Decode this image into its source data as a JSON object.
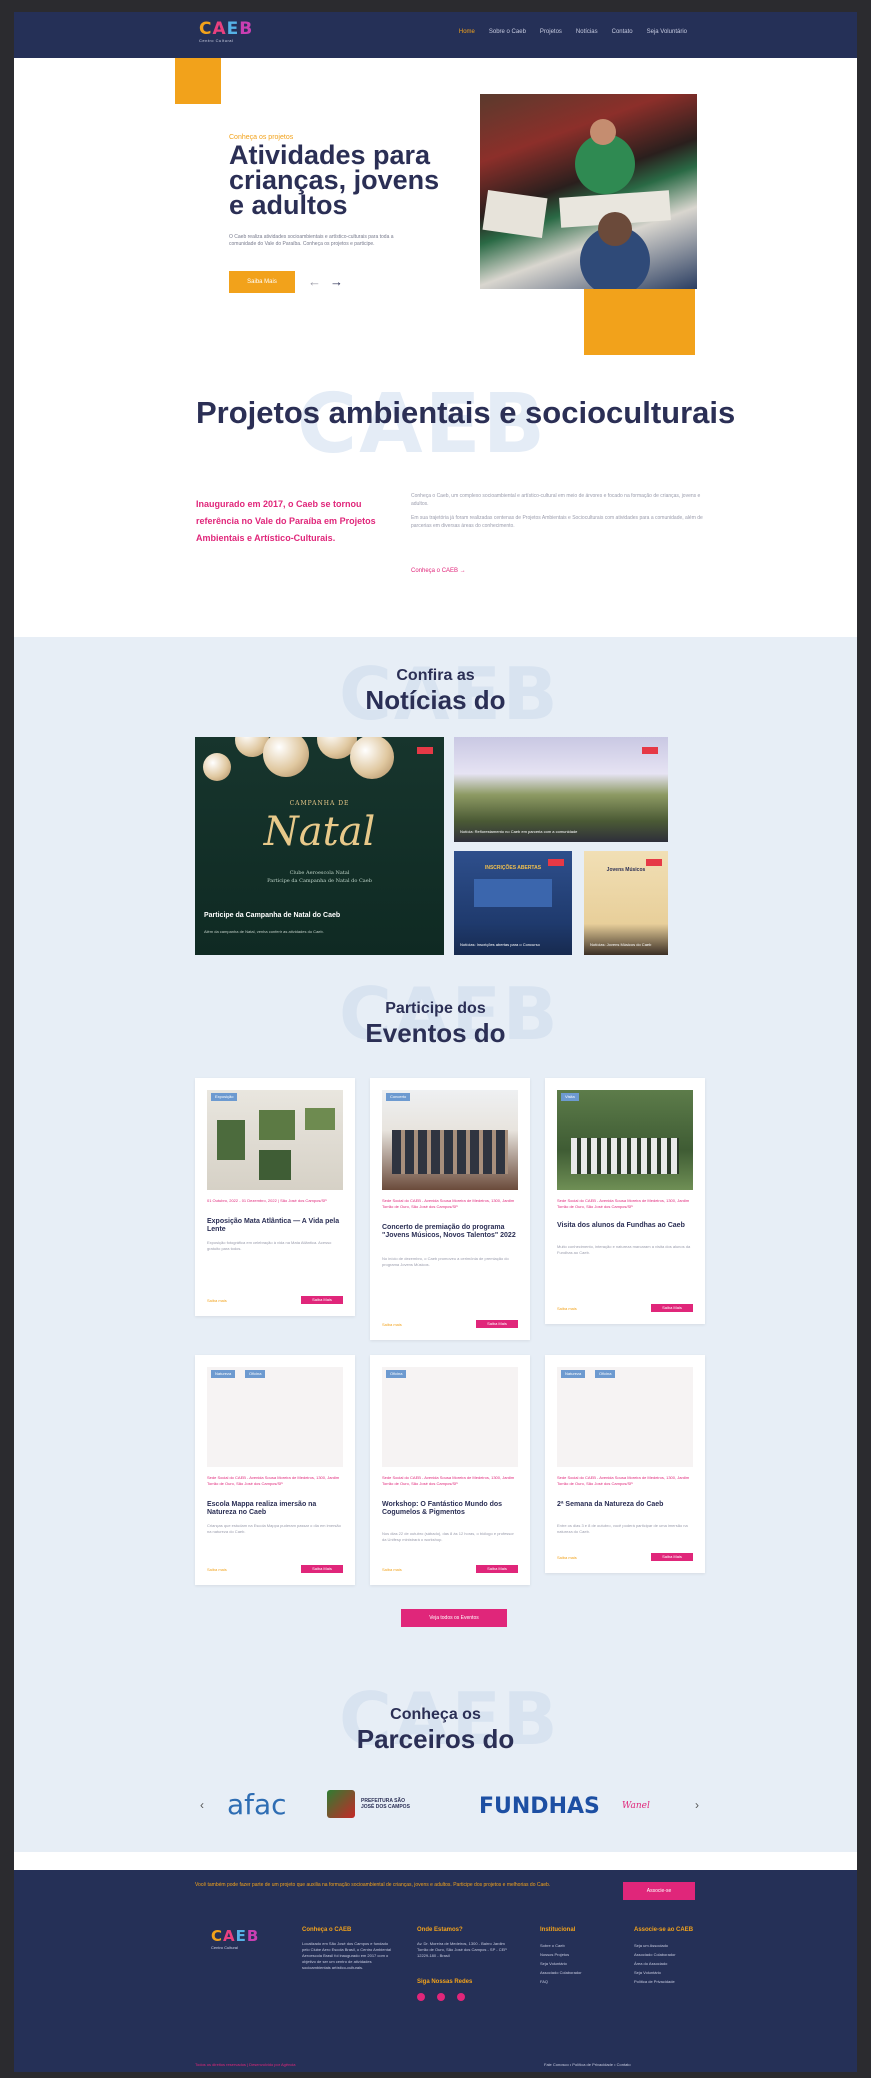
{
  "header": {
    "logo_text": "CAEB",
    "logo_sub": "Centro Cultural",
    "nav": [
      "Home",
      "Sobre o Caeb",
      "Projetos",
      "Notícias",
      "Contato",
      "Seja Voluntário"
    ]
  },
  "hero": {
    "kicker": "Conheça os projetos",
    "title": "Atividades para crianças, jovens e adultos",
    "desc": "O Caeb realiza atividades socioambientais e artístico-culturais para toda a comunidade do Vale do Paraíba. Conheça os projetos e participe.",
    "button": "Saiba Mais",
    "prev_icon": "←",
    "next_icon": "→"
  },
  "projects": {
    "watermark": "CAEB",
    "title": "Projetos ambientais e socioculturais",
    "lead": "Inaugurado em 2017, o Caeb se tornou referência no Vale do Paraíba em Projetos Ambientais e Artístico-Culturais.",
    "p1": "Conheça o Caeb, um complexo socioambiental e artístico-cultural em meio de árvores e focado na formação de crianças, jovens e adultos.",
    "p2": "Em sua trajetória já foram realizadas centenas de Projetos Ambientais e Socioculturais com atividades para a comunidade, além de parcerias em diversas áreas do conhecimento.",
    "link": "Conheça o CAEB →"
  },
  "news": {
    "watermark": "CAEB",
    "sub": "Confira as",
    "title": "Notícias do",
    "big_banner": "CAMPANHA DE",
    "big_script": "Natal",
    "big_line1": "Clube Aeroescola Natal",
    "big_line2": "Participe da Campanha de Natal do Caeb",
    "big_caption": "Participe da Campanha de Natal do Caeb",
    "big_desc": "Além da campanha de Natal, venha conferir as atividades do Caeb.",
    "small1_caption": "Notícia: Reflorestamento no Caeb em parceria com a comunidade",
    "small2_caption": "Notícias: Inscrições abertas para o Concurso",
    "small3_caption": "Notícias: Jovens Músicos do Caeb",
    "small2_banner": "INSCRIÇÕES ABERTAS",
    "small3_banner": "Jovens Músicos"
  },
  "events": {
    "watermark": "CAEB",
    "sub": "Participe dos",
    "title": "Eventos do",
    "cards": [
      {
        "tag": "Exposição",
        "meta": "01 Outubro, 2022 - 01 Dezembro, 2022 | São José dos Campos/SP",
        "title": "Exposição Mata Atlântica — A Vida pela Lente",
        "desc": "Exposição fotográfica em celebração à vida na Mata Atlântica. Acesso gratuito para todos.",
        "more": "Saiba mais",
        "btn": "Saiba Mais"
      },
      {
        "tag": "Concerto",
        "meta": "Sede Social do CAEB - Avenida Sousa Moreira de Medeiros, 1300, Jardim Torrão de Ouro, São José dos Campos/SP",
        "title": "Concerto de premiação do programa \"Jovens Músicos, Novos Talentos\" 2022",
        "desc": "No início de dezembro, o Caeb promoveu a cerimônia de premiação do programa Jovens Músicos.",
        "more": "Saiba mais",
        "btn": "Saiba Mais"
      },
      {
        "tag": "Visita",
        "meta": "Sede Social do CAEB - Avenida Sousa Moreira de Medeiros, 1300, Jardim Torrão de Ouro, São José dos Campos/SP",
        "title": "Visita dos alunos da Fundhas ao Caeb",
        "desc": "Muito conhecimento, interação e natureza marcaram a visita dos alunos da Fundhas ao Caeb.",
        "more": "Saiba mais",
        "btn": "Saiba Mais"
      },
      {
        "tag": "Natureza",
        "tag2": "Oficina",
        "meta": "Sede Social do CAEB - Avenida Sousa Moreira de Medeiros, 1300, Jardim Torrão de Ouro, São José dos Campos/SP",
        "title": "Escola Mappa realiza imersão na Natureza no Caeb",
        "desc": "Crianças que estudam na Escola Mappa puderam passar o dia em imersão na natureza do Caeb.",
        "more": "Saiba mais",
        "btn": "Saiba Mais"
      },
      {
        "tag": "Oficina",
        "meta": "Sede Social do CAEB - Avenida Sousa Moreira de Medeiros, 1300, Jardim Torrão de Ouro, São José dos Campos/SP",
        "title": "Workshop: O Fantástico Mundo dos Cogumelos & Pigmentos",
        "desc": "Nos dias 22 de outubro (sábado), das 8 às 12 horas, o biólogo e professor da Unifesp ministrará o workshop.",
        "more": "Saiba mais",
        "btn": "Saiba Mais"
      },
      {
        "tag": "Natureza",
        "tag2": "Oficina",
        "meta": "Sede Social do CAEB - Avenida Sousa Moreira de Medeiros, 1300, Jardim Torrão de Ouro, São José dos Campos/SP",
        "title": "2ª Semana da Natureza do Caeb",
        "desc": "Entre os dias 3 e 8 de outubro, você poderá participar de uma imersão na natureza do Caeb.",
        "more": "Saiba mais",
        "btn": "Saiba Mais"
      }
    ],
    "all_button": "Veja todos os Eventos"
  },
  "partners": {
    "watermark": "CAEB",
    "sub": "Conheça os",
    "title": "Parceiros do",
    "logos": [
      "afac",
      "PREFEITURA SÃO JOSÉ DOS CAMPOS",
      "FUNDHAS",
      "Wanel"
    ],
    "prev_icon": "‹",
    "next_icon": "›"
  },
  "footer": {
    "tagline": "Você também pode fazer parte de um projeto que auxilia na formação socioambiental de crianças, jovens e adultos. Participe dos projetos e melhorias do Caeb.",
    "cta": "Associe-se",
    "col1_title": "Conheça o CAEB",
    "col1_text": "Localizado em São José dos Campos e fundado pelo Clube Aero Escola Brasil, o Centro Ambiental Aeroescola Brasil foi inaugurado em 2017 com o objetivo de ser um centro de atividades socioambientais artístico-culturais.",
    "col2_title": "Onde Estamos?",
    "col2_text": "Av. Dr. Moreira de Medeiros, 1300 - Bairro Jardim Torrão de Ouro, São José dos Campos - SP - CEP 12229-180 - Brasil",
    "col2_sub": "Siga Nossas Redes",
    "col3_title": "Institucional",
    "col3_items": [
      "Sobre o Caeb",
      "Nossos Projetos",
      "Seja Voluntário",
      "Associado Colaborador",
      "FAQ"
    ],
    "col4_title": "Associe-se ao CAEB",
    "col4_items": [
      "Seja um Associado",
      "Associado Colaborador",
      "Área do Associado",
      "Seja Voluntário",
      "Política de Privacidade"
    ],
    "copyright": "Todos os direitos reservados | Desenvolvido por Agência",
    "bottom_links": "Fale Conosco • Política de Privacidade • Contato"
  }
}
